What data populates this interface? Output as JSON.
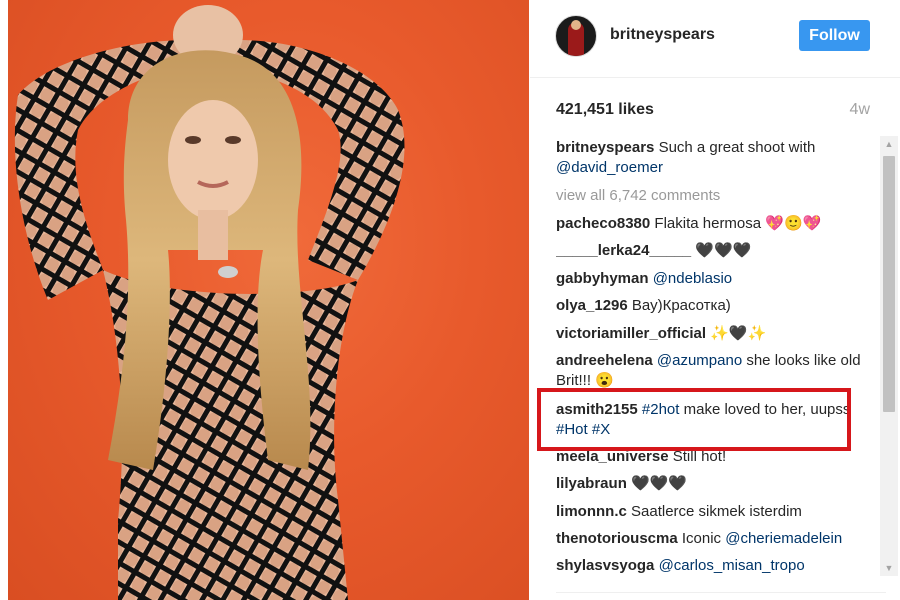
{
  "profile": {
    "username": "britneyspears",
    "follow_label": "Follow"
  },
  "post": {
    "likes": "421,451 likes",
    "age": "4w"
  },
  "caption": {
    "user": "britneyspears",
    "text": "Such a great shoot with",
    "mention": "@david_roemer"
  },
  "view_all": "view all 6,742 comments",
  "comments": [
    {
      "user": "pacheco8380",
      "text": "Flakita hermosa 💖🙂💖"
    },
    {
      "user": "_____lerka24_____",
      "text": "🖤🖤🖤"
    },
    {
      "user": "gabbyhyman",
      "mention": "@ndeblasio"
    },
    {
      "user": "olya_1296",
      "text": "Вау)Красотка)"
    },
    {
      "user": "victoriamiller_official",
      "text": "✨🖤✨"
    },
    {
      "user": "andreehelena",
      "mention": "@azumpano",
      "text": "she looks like old Brit!!! 😮"
    },
    {
      "user": "asmith2155",
      "mention": "#2hot",
      "text": "make loved to her, uupss",
      "tags": "#Hot #X"
    },
    {
      "user": "meela_universe",
      "text": "Still hot!"
    },
    {
      "user": "lilyabraun",
      "text": "🖤🖤🖤"
    },
    {
      "user": "limonnn.c",
      "text": "Saatlerce sikmek isterdim"
    },
    {
      "user": "thenotoriouscma",
      "text": "Iconic",
      "mention": "@cheriemadelein"
    },
    {
      "user": "shylasvsyoga",
      "mention": "@carlos_misan_tropo"
    }
  ],
  "colors": {
    "follow_bg": "#3897f0",
    "highlight": "#d6171b",
    "photo_bg": "#e85a2c",
    "mention": "#003569"
  },
  "icons": [
    "scroll-up-arrow-icon",
    "scroll-down-arrow-icon"
  ]
}
